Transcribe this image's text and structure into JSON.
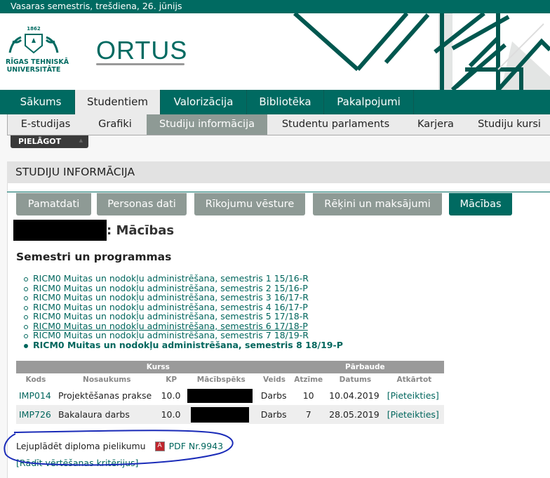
{
  "topbar": {
    "text": "Vasaras semestris, trešdiena, 26. jūnijs"
  },
  "logo": {
    "year": "1862",
    "line1": "RĪGAS TEHNISKĀ",
    "line2": "UNIVERSITĀTE",
    "portal": "ORTUS"
  },
  "mainnav": [
    {
      "label": "Sākums"
    },
    {
      "label": "Studentiem"
    },
    {
      "label": "Valorizācija"
    },
    {
      "label": "Bibliotēka"
    },
    {
      "label": "Pakalpojumi"
    }
  ],
  "subnav": [
    {
      "label": "E-studijas"
    },
    {
      "label": "Grafiki"
    },
    {
      "label": "Studiju informācija"
    },
    {
      "label": "Studentu parlaments"
    },
    {
      "label": "Karjera"
    },
    {
      "label": "Studiju kursi"
    }
  ],
  "pielagot": "PIELĀGOT",
  "panel": {
    "title": "STUDIJU INFORMĀCIJA"
  },
  "tabs": [
    {
      "label": "Pamatdati"
    },
    {
      "label": "Personas dati"
    },
    {
      "label": "Rīkojumu vēsture"
    },
    {
      "label": "Rēķini un maksājumi"
    },
    {
      "label": "Mācības"
    }
  ],
  "heading": ": Mācības",
  "section_title": "Semestri un programmas",
  "semesters": [
    "RICM0 Muitas un nodokļu administrēšana, semestris 1 15/16-R",
    "RICM0 Muitas un nodokļu administrēšana, semestris 2 15/16-P",
    "RICM0 Muitas un nodokļu administrēšana, semestris 3 16/17-R",
    "RICM0 Muitas un nodokļu administrēšana, semestris 4 16/17-P",
    "RICM0 Muitas un nodokļu administrēšana, semestris 5 17/18-R",
    "RICM0 Muitas un nodokļu administrēšana, semestris 6 17/18-P",
    "RICM0 Muitas un nodokļu administrēšana, semestris 7 18/19-R",
    "RICM0 Muitas un nodokļu administrēšana, semestris 8 18/19-P"
  ],
  "table": {
    "group_headers": [
      "Kurss",
      "Pārbaude"
    ],
    "columns": [
      "Kods",
      "Nosaukums",
      "KP",
      "Mācībspēks",
      "Veids",
      "Atzīme",
      "Datums",
      "Atkārtot"
    ],
    "rows": [
      {
        "kods": "IMP014",
        "nosaukums": "Projektēšanas prakse",
        "kp": "10.0",
        "veids": "Darbs",
        "atzime": "10",
        "datums": "10.04.2019",
        "atkartot": "[Pieteikties]"
      },
      {
        "kods": "IMP726",
        "nosaukums": "Bakalaura darbs",
        "kp": "10.0",
        "veids": "Darbs",
        "atzime": "7",
        "datums": "28.05.2019",
        "atkartot": "[Pieteikties]"
      }
    ]
  },
  "download": {
    "label": "Lejuplādēt diploma pielikumu",
    "link": "PDF Nr.9943"
  },
  "criteria_link": "[Rādīt vērtēšanas kritērijus]",
  "colors": {
    "brand": "#006a61",
    "tab_gray": "#8e9a95",
    "annotation": "#1a2bb8"
  }
}
